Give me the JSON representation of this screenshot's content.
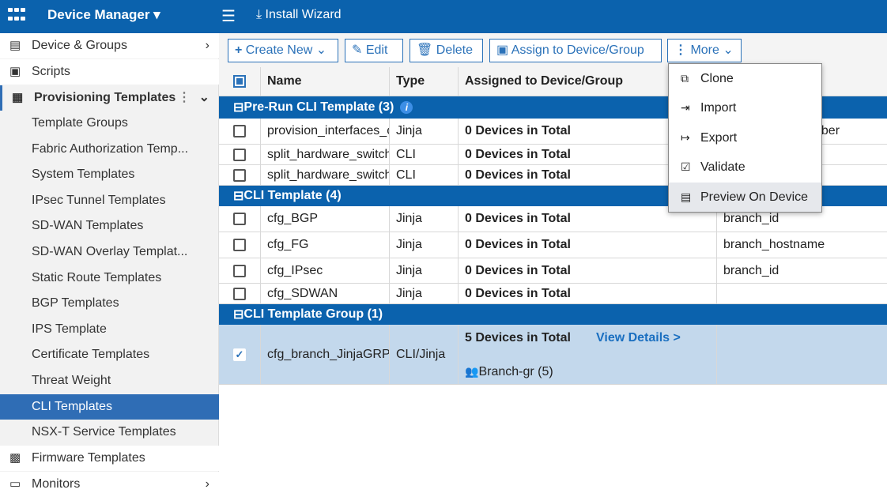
{
  "topbar": {
    "title": "Device Manager ▾",
    "install_wizard": "Install Wizard"
  },
  "sidebar": {
    "items": [
      {
        "label": "Device & Groups",
        "icon": "device-icon"
      },
      {
        "label": "Scripts",
        "icon": "script-icon"
      },
      {
        "label": "Provisioning Templates",
        "icon": "template-icon"
      },
      {
        "label": "Template Groups"
      },
      {
        "label": "Fabric Authorization Temp..."
      },
      {
        "label": "System Templates"
      },
      {
        "label": "IPsec Tunnel Templates"
      },
      {
        "label": "SD-WAN Templates"
      },
      {
        "label": "SD-WAN Overlay Templat..."
      },
      {
        "label": "Static Route Templates"
      },
      {
        "label": "BGP Templates"
      },
      {
        "label": "IPS Template"
      },
      {
        "label": "Certificate Templates"
      },
      {
        "label": "Threat Weight"
      },
      {
        "label": "CLI Templates"
      },
      {
        "label": "NSX-T Service Templates"
      },
      {
        "label": "Firmware Templates",
        "icon": "chip-icon"
      },
      {
        "label": "Monitors",
        "icon": "monitor-icon"
      }
    ]
  },
  "toolbar": {
    "create_new": "Create New",
    "edit": "Edit",
    "delete": "Delete",
    "assign": "Assign to Device/Group",
    "more": "More"
  },
  "table": {
    "headers": {
      "name": "Name",
      "type": "Type",
      "assigned": "Assigned to Device/Group"
    },
    "groups": [
      "Pre-Run CLI Template (3)",
      "CLI Template (4)",
      "CLI Template Group (1)"
    ],
    "rows": [
      {
        "name": "provision_interfaces_c",
        "type": "Jinja",
        "assigned": "0 Devices in Total",
        "extra": "nber"
      },
      {
        "name": "split_hardware_switch",
        "type": "CLI",
        "assigned": "0 Devices in Total",
        "extra": ""
      },
      {
        "name": "split_hardware_switch",
        "type": "CLI",
        "assigned": "0 Devices in Total",
        "extra": ""
      },
      {
        "name": "cfg_BGP",
        "type": "Jinja",
        "assigned": "0 Devices in Total",
        "extra": "branch_id"
      },
      {
        "name": "cfg_FG",
        "type": "Jinja",
        "assigned": "0 Devices in Total",
        "extra": "branch_hostname"
      },
      {
        "name": "cfg_IPsec",
        "type": "Jinja",
        "assigned": "0 Devices in Total",
        "extra": "branch_id"
      },
      {
        "name": "cfg_SDWAN",
        "type": "Jinja",
        "assigned": "0 Devices in Total",
        "extra": ""
      },
      {
        "name": "cfg_branch_JinjaGRP",
        "type": "CLI/Jinja",
        "assigned": "5 Devices in Total",
        "view_details": "View Details >",
        "group": "Branch-gr (5)"
      }
    ]
  },
  "more_menu": [
    "Clone",
    "Import",
    "Export",
    "Validate",
    "Preview On Device"
  ]
}
